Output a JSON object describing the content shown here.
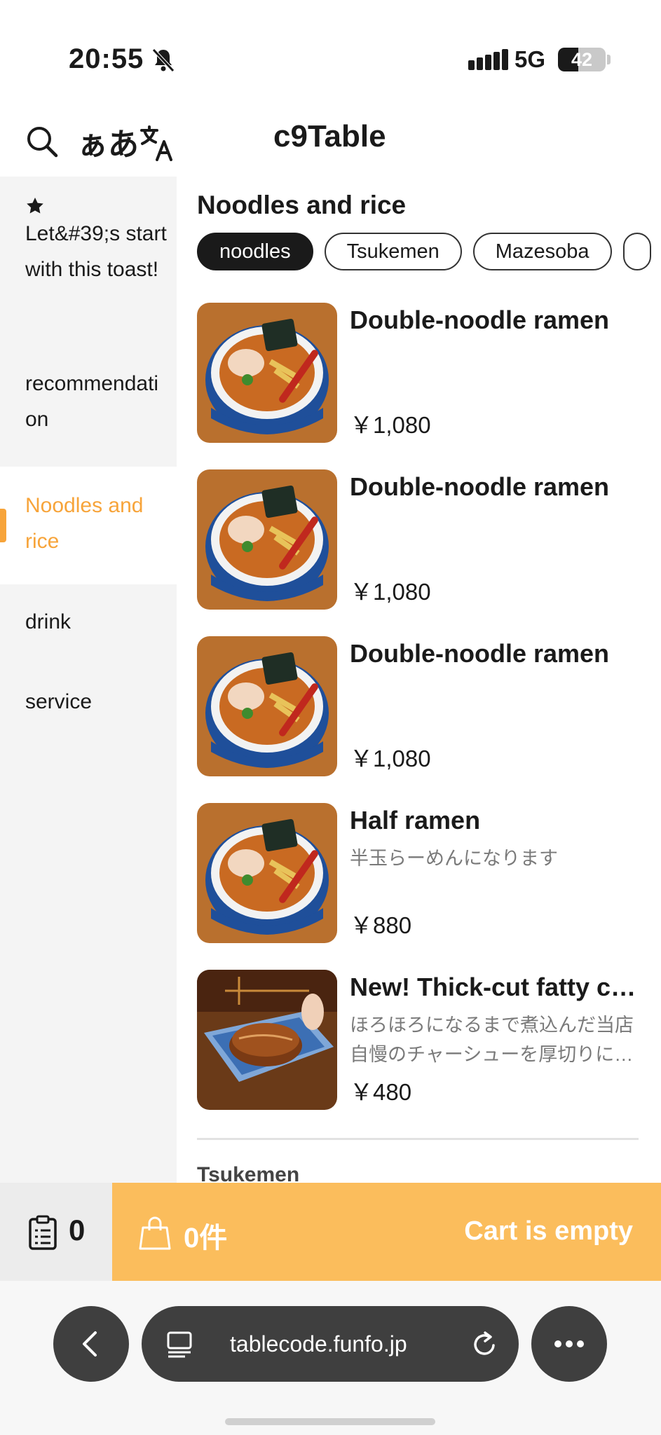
{
  "status_bar": {
    "time": "20:55",
    "network": "5G",
    "battery": "42",
    "battery_level": 0.42
  },
  "header": {
    "font_toggle_label": "ぁあ",
    "title": "c9Table"
  },
  "sidebar": {
    "items": [
      {
        "label": "Let&#39;s start with this toast!",
        "has_star": true
      },
      {
        "label": "recommendation"
      },
      {
        "label": "Noodles and rice",
        "active": true
      },
      {
        "label": "drink"
      },
      {
        "label": "service"
      }
    ]
  },
  "main": {
    "section_title": "Noodles and rice",
    "chips": [
      "noodles",
      "Tsukemen",
      "Mazesoba"
    ],
    "active_chip": "noodles",
    "items": [
      {
        "name": "Double-noodle ramen",
        "description": "",
        "price": "￥1,080",
        "image": "ramen-bowl"
      },
      {
        "name": "Double-noodle ramen",
        "description": "",
        "price": "￥1,080",
        "image": "ramen-bowl"
      },
      {
        "name": "Double-noodle ramen",
        "description": "",
        "price": "￥1,080",
        "image": "ramen-bowl"
      },
      {
        "name": "Half ramen",
        "description": "半玉らーめんになります",
        "price": "￥880",
        "image": "ramen-bowl"
      },
      {
        "name": "New! Thick-cut fatty chashu",
        "description": "ほろほろになるまで煮込んだ当店自慢のチャーシューを厚切りにしました",
        "price": "￥480",
        "image": "chashu-plate"
      }
    ],
    "next_section_title": "Tsukemen"
  },
  "order_bar": {
    "history_count": "0",
    "cart_count": "0件",
    "cart_status": "Cart is empty"
  },
  "browser": {
    "url": "tablecode.funfo.jp"
  },
  "colors": {
    "accent": "#f7a43a",
    "cart_bg": "#fbbd5c",
    "sidebar_bg": "#f4f4f4",
    "browser_button": "#3f3f3f"
  }
}
